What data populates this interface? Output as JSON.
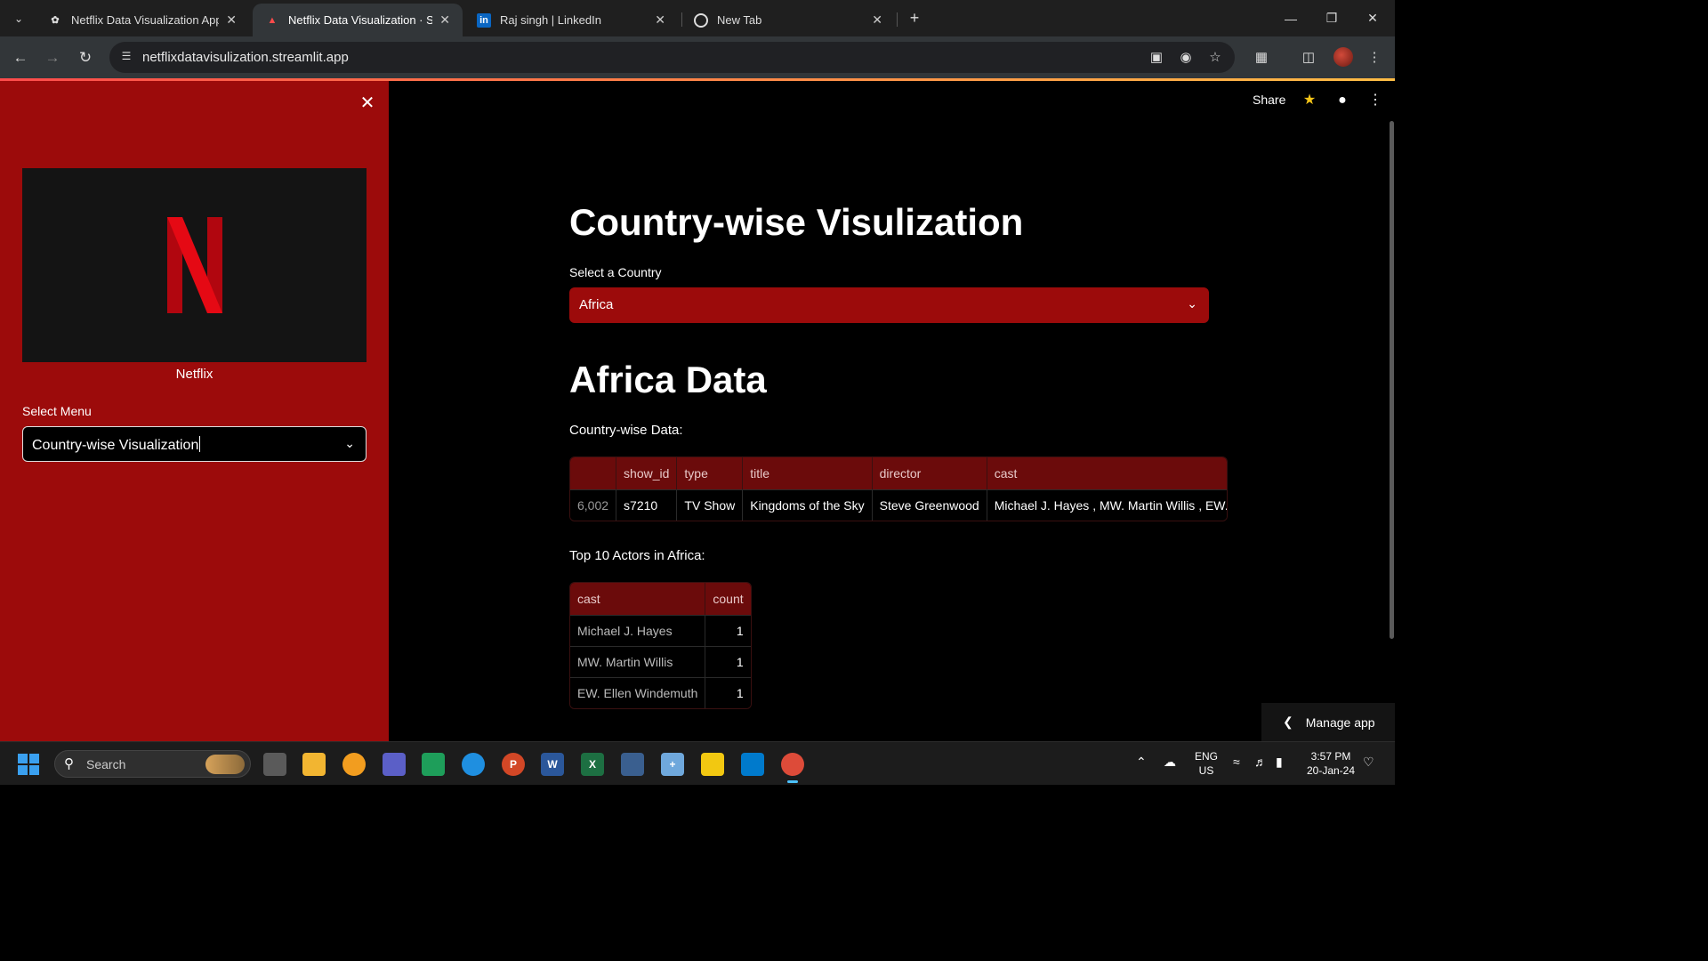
{
  "browser": {
    "tabs": [
      {
        "title": "Netflix Data Visualization App",
        "icon": "openai-icon",
        "active": false
      },
      {
        "title": "Netflix Data Visualization · Strea",
        "icon": "streamlit-icon",
        "active": true
      },
      {
        "title": "Raj singh | LinkedIn",
        "icon": "linkedin-icon",
        "active": false
      },
      {
        "title": "New Tab",
        "icon": "chrome-icon",
        "active": false
      }
    ],
    "url": "netflixdatavisulization.streamlit.app"
  },
  "sidebar": {
    "logo_caption": "Netflix",
    "select_label": "Select Menu",
    "select_value": "Country-wise Visualization"
  },
  "header": {
    "share_label": "Share"
  },
  "main": {
    "title": "Country-wise Visulization",
    "country_label": "Select a Country",
    "country_value": "Africa",
    "subtitle": "Africa Data",
    "data_label": "Country-wise Data:",
    "data_table": {
      "columns": [
        "",
        "show_id",
        "type",
        "title",
        "director",
        "cast"
      ],
      "rows": [
        [
          "6,002",
          "s7210",
          "TV Show",
          "Kingdoms of the Sky",
          "Steve Greenwood",
          "Michael J. Hayes , MW. Martin Willis , EW. Elle"
        ]
      ]
    },
    "actors_label": "Top 10 Actors in Africa:",
    "actors_table": {
      "columns": [
        "cast",
        "count"
      ],
      "rows": [
        [
          "Michael J. Hayes",
          "1"
        ],
        [
          "MW. Martin Willis",
          "1"
        ],
        [
          "EW. Ellen Windemuth",
          "1"
        ]
      ]
    },
    "manage_app_label": "Manage app"
  },
  "taskbar": {
    "search_placeholder": "Search",
    "lang_line1": "ENG",
    "lang_line2": "US",
    "time": "3:57 PM",
    "date": "20-Jan-24"
  },
  "colors": {
    "sidebar_bg": "#9c0b0b",
    "accent_red": "#e50914",
    "table_header_bg": "#6b0b0b"
  }
}
